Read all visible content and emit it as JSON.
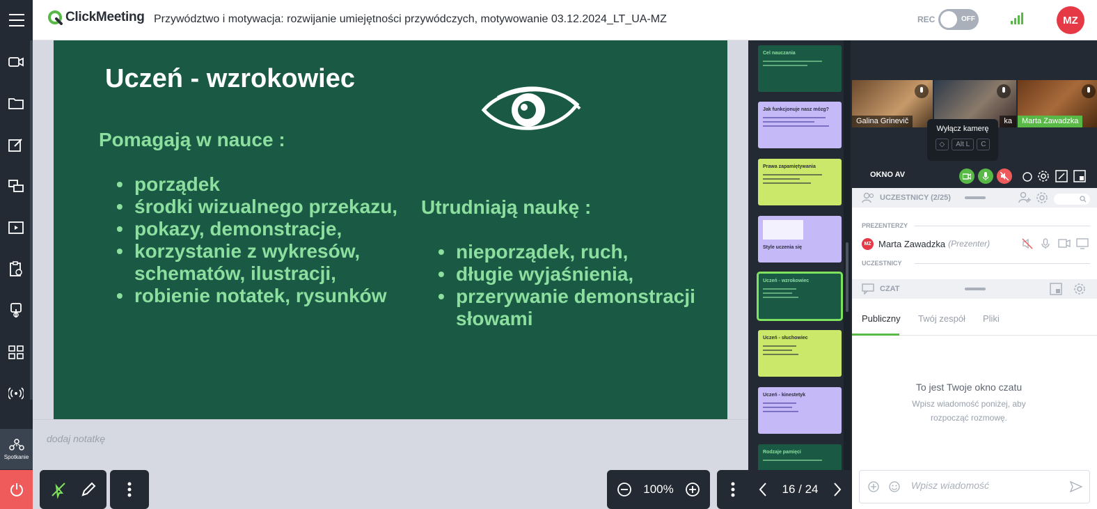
{
  "header": {
    "logo_text": "ClickMeeting",
    "meeting_title": "Przywództwo i motywacja: rozwijanie umiejętności przywódczych, motywowanie 03.12.2024_LT_UA-MZ",
    "rec_label": "REC",
    "rec_state": "OFF",
    "user_initials": "MZ"
  },
  "sidebar": {
    "meeting_label": "Spotkanie"
  },
  "slide": {
    "title": "Uczeń - wzrokowiec",
    "help_heading": "Pomagają w nauce :",
    "help_items": [
      "porządek",
      "środki wizualnego przekazu,",
      "pokazy, demonstracje,",
      "korzystanie z wykresów, schematów, ilustracji,",
      "robienie notatek, rysunków"
    ],
    "hinder_heading": "Utrudniają naukę :",
    "hinder_items": [
      "nieporządek, ruch,",
      "długie wyjaśnienia,",
      "przerywanie demonstracji słowami"
    ]
  },
  "notes": {
    "placeholder": "dodaj notatkę"
  },
  "zoom": {
    "value": "100%"
  },
  "pager": {
    "text": "16 / 24"
  },
  "thumbnails": [
    {
      "title": "Cel nauczania",
      "bg": "#1a5a45",
      "fg": "#8cdf9e"
    },
    {
      "title": "Jak funkcjonuje nasz mózg?",
      "bg": "#c5b9f7",
      "fg": "#2a2f37"
    },
    {
      "title": "Prawa zapamiętywania",
      "bg": "#cbe86b",
      "fg": "#2a2f37"
    },
    {
      "title": "Style uczenia się",
      "bg": "#c5b9f7",
      "fg": "#2a2f37"
    },
    {
      "title": "Uczeń - wzrokowiec",
      "bg": "#1a5a45",
      "fg": "#8cdf9e"
    },
    {
      "title": "Uczeń - słuchowiec",
      "bg": "#cbe86b",
      "fg": "#2a2f37"
    },
    {
      "title": "Uczeń - kinestetyk",
      "bg": "#c5b9f7",
      "fg": "#2a2f37"
    },
    {
      "title": "Rodzaje pamięci",
      "bg": "#1a5a45",
      "fg": "#8cdf9e"
    }
  ],
  "videos": [
    {
      "name": "Galina Grinevič"
    },
    {
      "name": "ka"
    },
    {
      "name": "Marta Zawadzka"
    }
  ],
  "tooltip": {
    "title": "Wyłącz kamerę",
    "key_alt": "Alt L",
    "key_c": "C"
  },
  "av": {
    "label": "OKNO AV"
  },
  "participants": {
    "heading": "UCZESTNICY (2/25)",
    "presenters_label": "PREZENTERZY",
    "attendees_label": "UCZESTNICY",
    "presenter_initials": "MZ",
    "presenter_name": "Marta Zawadzka",
    "presenter_role": "(Prezenter)"
  },
  "chat": {
    "heading": "CZAT",
    "tabs": [
      "Publiczny",
      "Twój zespół",
      "Pliki"
    ],
    "empty_title": "To jest Twoje okno czatu",
    "empty_sub": "Wpisz wiadomość poniżej, aby rozpocząć rozmowę.",
    "input_placeholder": "Wpisz wiadomość"
  },
  "colors": {
    "accent": "#58b947",
    "slide_bg": "#1a5a45",
    "slide_text": "#8cdf9e",
    "danger": "#e63946"
  }
}
